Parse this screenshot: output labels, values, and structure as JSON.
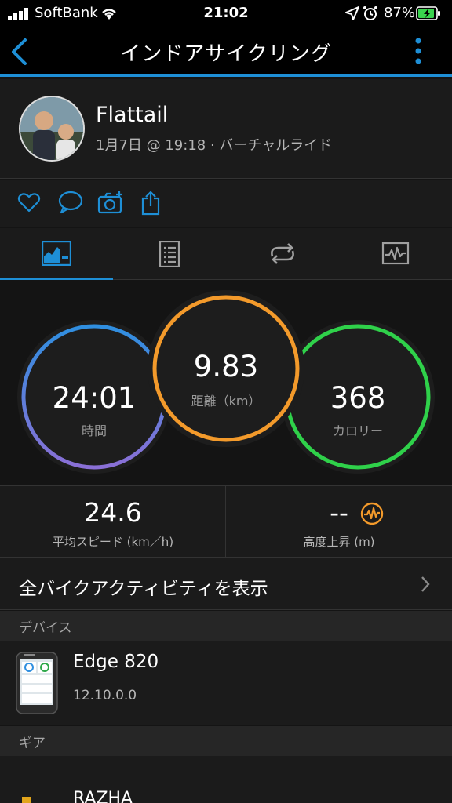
{
  "status_bar": {
    "carrier": "SoftBank",
    "time": "21:02",
    "battery_percent": "87%"
  },
  "header": {
    "title": "インドアサイクリング"
  },
  "profile": {
    "name": "Flattail",
    "meta": "1月7日 @ 19:18 · バーチャルライド"
  },
  "summary": {
    "time": {
      "value": "24:01",
      "label": "時間"
    },
    "distance": {
      "value": "9.83",
      "label": "距離（km）"
    },
    "calories": {
      "value": "368",
      "label": "カロリー"
    }
  },
  "stats": {
    "avg_speed": {
      "value": "24.6",
      "label": "平均スピード (km／h)"
    },
    "elevation_gain": {
      "value": "--",
      "label": "高度上昇 (m)"
    }
  },
  "link_row": {
    "label": "全バイクアクティビティを表示"
  },
  "devices_section": {
    "header": "デバイス",
    "device_name": "Edge 820",
    "device_version": "12.10.0.0"
  },
  "gear_section": {
    "header": "ギア",
    "gear_name": "RAZHA"
  },
  "colors": {
    "accent": "#1e8fd6",
    "time_ring": "#8a6fd6",
    "distance_ring": "#f39a2b",
    "calories_ring": "#2fd14a",
    "background": "#141414"
  }
}
